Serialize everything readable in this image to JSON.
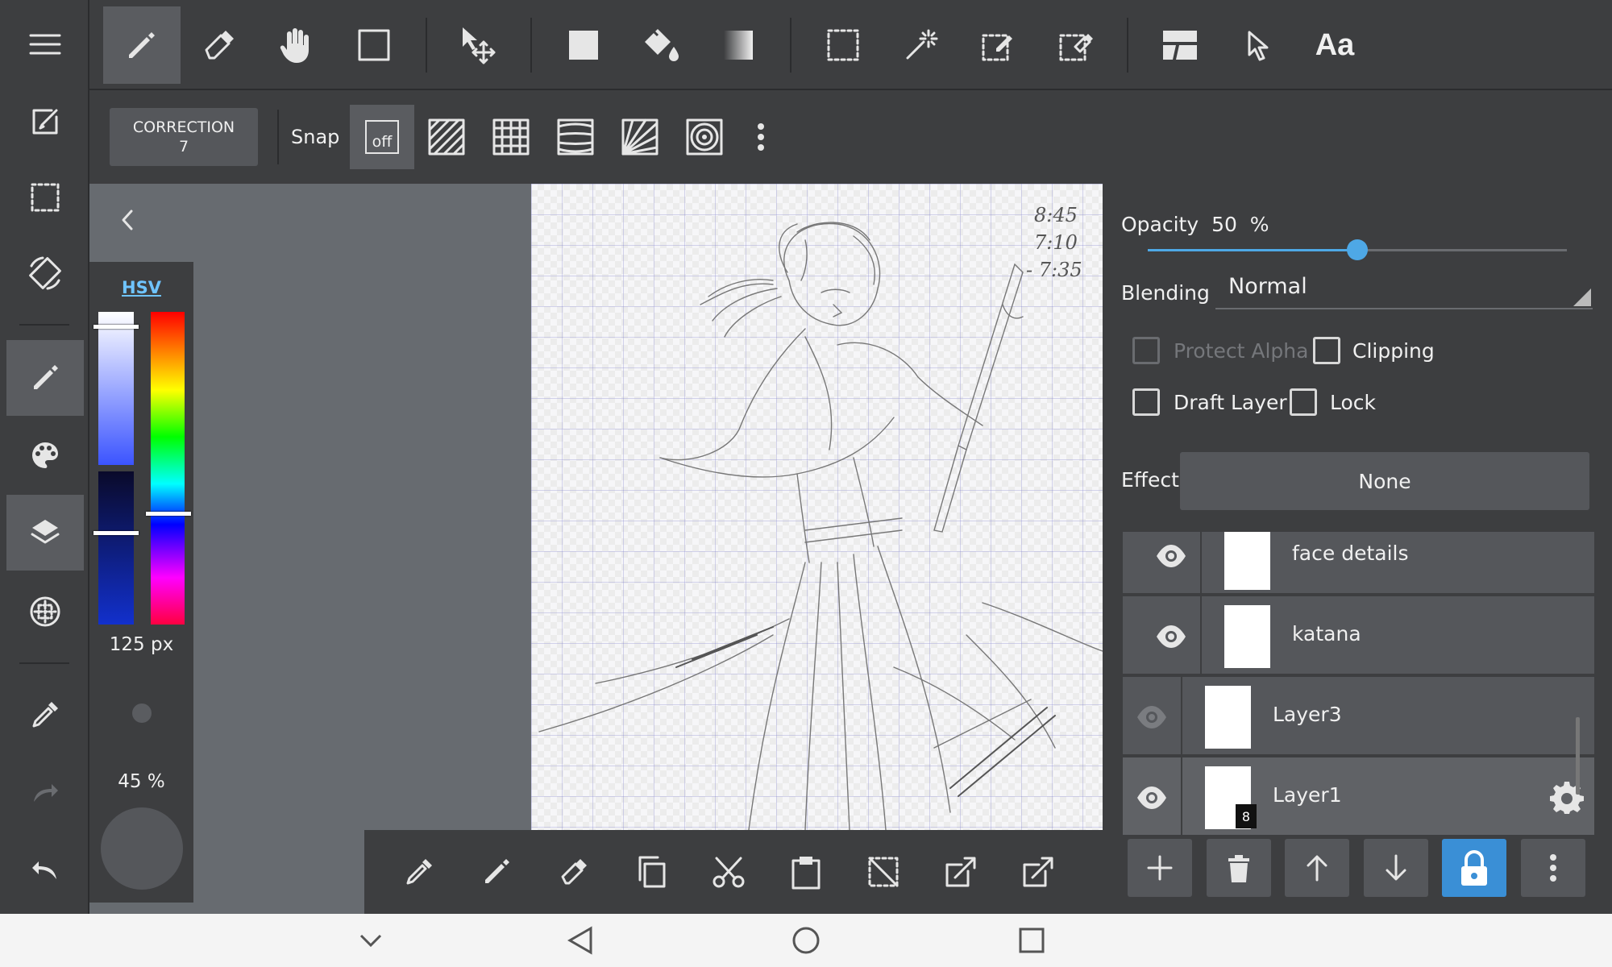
{
  "toolbar": {
    "text_tool_label": "Aa",
    "correction_label": "CORRECTION",
    "correction_value": "7",
    "snap_label": "Snap",
    "snap_off_label": "off"
  },
  "color_panel": {
    "mode_label": "HSV",
    "brush_size": "125 px",
    "brush_opacity": "45 %"
  },
  "canvas": {
    "note_line1": "8:45",
    "note_line2": "7:10",
    "note_line3": "- 7:35"
  },
  "layer_properties": {
    "opacity_label": "Opacity",
    "opacity_value": "50",
    "opacity_unit": "%",
    "opacity_fraction": 0.5,
    "blending_label": "Blending",
    "blending_value": "Normal",
    "protect_alpha_label": "Protect Alpha",
    "clipping_label": "Clipping",
    "draft_layer_label": "Draft Layer",
    "lock_label": "Lock",
    "effect_label": "Effect",
    "effect_value": "None"
  },
  "layers": [
    {
      "name": "face details",
      "visible": true,
      "clipped": true
    },
    {
      "name": "katana",
      "visible": true,
      "clipped": true
    },
    {
      "name": "Layer3",
      "visible": false,
      "clipped": false
    },
    {
      "name": "Layer1",
      "visible": true,
      "clipped": false,
      "badge": "8",
      "selected": true
    }
  ],
  "colors": {
    "accent": "#4ea8e6",
    "panel": "#3d3e40",
    "button": "#55575b",
    "workspace": "#676b70"
  }
}
